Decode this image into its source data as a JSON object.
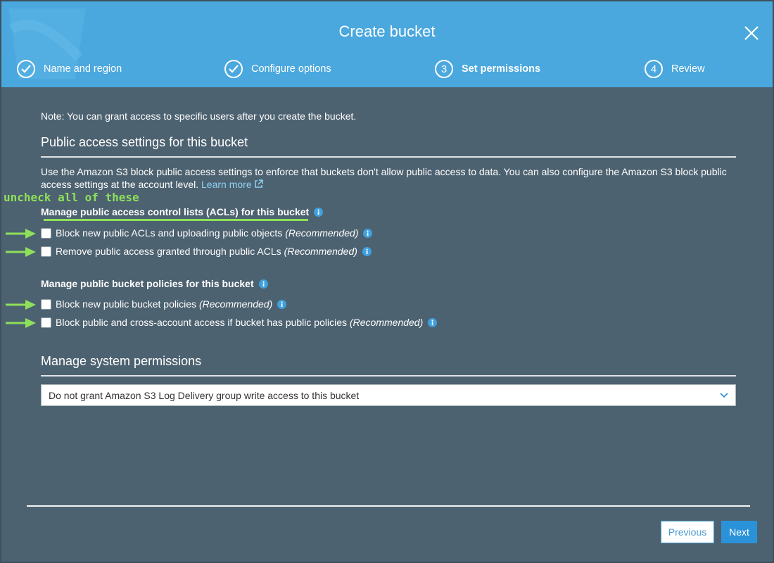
{
  "header": {
    "title": "Create bucket",
    "steps": [
      {
        "label": "Name and region",
        "state": "complete"
      },
      {
        "label": "Configure options",
        "state": "complete"
      },
      {
        "number": "3",
        "label": "Set permissions",
        "state": "active"
      },
      {
        "number": "4",
        "label": "Review",
        "state": "pending"
      }
    ]
  },
  "main": {
    "note": "Note: You can grant access to specific users after you create the bucket.",
    "public_access_title": "Public access settings for this bucket",
    "description": "Use the Amazon S3 block public access settings to enforce that buckets don't allow public access to data. You can also configure the Amazon S3 block public access settings at the account level.",
    "learn_more": "Learn more",
    "annotation": "uncheck all of these",
    "acl_group_title": "Manage public access control lists (ACLs) for this bucket",
    "acl_options": [
      {
        "label": "Block new public ACLs and uploading public objects",
        "recommended": "(Recommended)",
        "checked": false
      },
      {
        "label": "Remove public access granted through public ACLs",
        "recommended": "(Recommended)",
        "checked": false
      }
    ],
    "policy_group_title": "Manage public bucket policies for this bucket",
    "policy_options": [
      {
        "label": "Block new public bucket policies",
        "recommended": "(Recommended)",
        "checked": false
      },
      {
        "label": "Block public and cross-account access if bucket has public policies",
        "recommended": "(Recommended)",
        "checked": false
      }
    ],
    "system_permissions_title": "Manage system permissions",
    "system_permissions_select": "Do not grant Amazon S3 Log Delivery group write access to this bucket"
  },
  "footer": {
    "previous_label": "Previous",
    "next_label": "Next"
  },
  "colors": {
    "header_bg": "#4aa8de",
    "body_bg": "#4d6270",
    "annotation_green": "#8ee05a",
    "link": "#8ed1f7",
    "primary_button": "#2a92d9"
  },
  "icons": [
    "check-circle-icon",
    "close-icon",
    "info-icon",
    "external-link-icon",
    "chevron-down-icon",
    "arrow-right-annotation"
  ]
}
